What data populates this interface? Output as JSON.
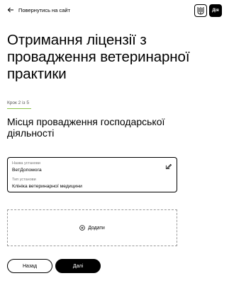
{
  "header": {
    "back_label": "Повернутись на сайт",
    "diia_logo": "Дія",
    "icons": {
      "back": "arrow-left-icon",
      "trident": "trident-icon"
    }
  },
  "page_title": "Отримання ліцензії з провадження ветеринарної практики",
  "step": {
    "label": "Крок 2 із 5",
    "accent_color": "#8bc34a"
  },
  "section_title": "Місця провадження господарської діяльності",
  "card": {
    "fields": [
      {
        "label": "Назва установи",
        "value": "ВетДопомога"
      },
      {
        "label": "Тип установи",
        "value": "Клініка ветеринарної медицини"
      }
    ],
    "edit_icon": "edit-icon"
  },
  "add": {
    "label": "Додати",
    "icon": "plus-circle-icon"
  },
  "buttons": {
    "back_label": "Назад",
    "next_label": "Далі"
  }
}
